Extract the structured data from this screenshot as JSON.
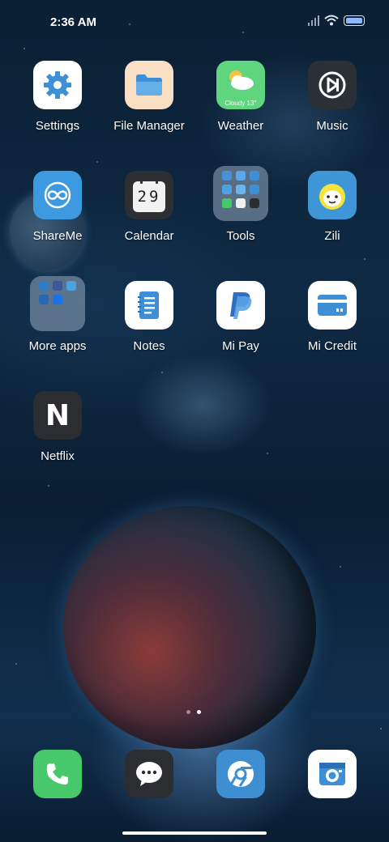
{
  "status_bar": {
    "time": "2:36 AM"
  },
  "apps": [
    {
      "id": "settings",
      "label": "Settings"
    },
    {
      "id": "file-manager",
      "label": "File Manager"
    },
    {
      "id": "weather",
      "label": "Weather",
      "badge_text": "Cloudy 13°"
    },
    {
      "id": "music",
      "label": "Music"
    },
    {
      "id": "shareme",
      "label": "ShareMe"
    },
    {
      "id": "calendar",
      "label": "Calendar",
      "day": "29"
    },
    {
      "id": "tools",
      "label": "Tools"
    },
    {
      "id": "zili",
      "label": "Zili"
    },
    {
      "id": "more-apps",
      "label": "More apps"
    },
    {
      "id": "notes",
      "label": "Notes"
    },
    {
      "id": "mi-pay",
      "label": "Mi Pay"
    },
    {
      "id": "mi-credit",
      "label": "Mi Credit"
    },
    {
      "id": "netflix",
      "label": "Netflix",
      "glyph": "N"
    }
  ],
  "dock": [
    {
      "id": "phone",
      "icon": "phone-icon"
    },
    {
      "id": "messages",
      "icon": "message-icon"
    },
    {
      "id": "chrome",
      "icon": "browser-icon"
    },
    {
      "id": "camera",
      "icon": "camera-icon"
    }
  ],
  "page_indicator": {
    "pages": 2,
    "current": 2
  },
  "colors": {
    "settings_bg": "#ffffff",
    "settings_fg": "#3f8fd6",
    "file_manager_bg": "#f9dfc4",
    "weather_bg": "#5fd57e",
    "music_bg": "#2b2f36",
    "shareme_bg": "#3d9ae0",
    "calendar_bg": "#2d2f33",
    "zili_bg": "#3f96d6",
    "notes_bg": "#ffffff",
    "mipay_bg": "#ffffff",
    "micredit_bg": "#ffffff",
    "netflix_bg": "#2b2d31",
    "phone_bg": "#47c96b",
    "messages_bg": "#2b2d31",
    "chrome_bg": "#3d8fd1",
    "camera_bg": "#ffffff"
  }
}
